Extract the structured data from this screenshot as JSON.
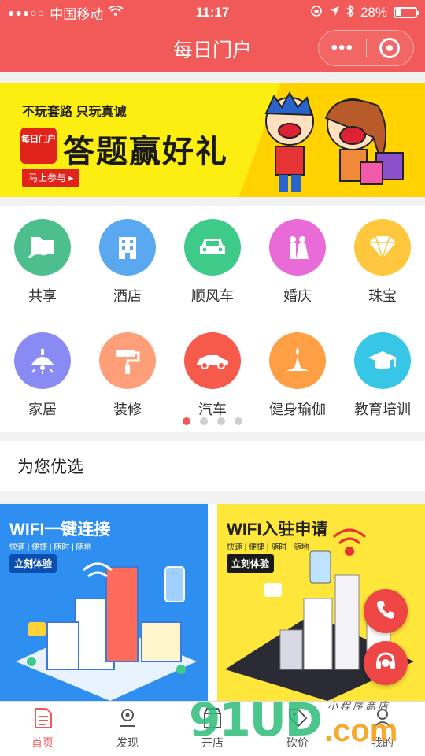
{
  "status": {
    "carrier": "中国移动",
    "time": "11:17",
    "battery": "28%",
    "battery_level": 0.28
  },
  "nav": {
    "title": "每日门户"
  },
  "banner": {
    "slogan": "不玩套路  只玩真诚",
    "logo": "每日门户",
    "headline": "答题赢好礼",
    "cta": "马上参与"
  },
  "categories": [
    {
      "label": "共享",
      "color": "#4cbf8c",
      "icon": "folder-hand-icon"
    },
    {
      "label": "酒店",
      "color": "#5aa8f0",
      "icon": "building-icon"
    },
    {
      "label": "顺风车",
      "color": "#3ecb8a",
      "icon": "car-front-icon"
    },
    {
      "label": "婚庆",
      "color": "#e86bd7",
      "icon": "couple-icon"
    },
    {
      "label": "珠宝",
      "color": "#ffc73d",
      "icon": "diamond-icon"
    },
    {
      "label": "家居",
      "color": "#8a8af5",
      "icon": "lamp-icon"
    },
    {
      "label": "装修",
      "color": "#ff9f7a",
      "icon": "paint-roller-icon"
    },
    {
      "label": "汽车",
      "color": "#f55a4a",
      "icon": "car-side-icon"
    },
    {
      "label": "健身瑜伽",
      "color": "#ff9f45",
      "icon": "yoga-icon"
    },
    {
      "label": "教育培训",
      "color": "#38c6e6",
      "icon": "graduation-cap-icon"
    }
  ],
  "pager": {
    "pages": 4,
    "active": 0
  },
  "section": {
    "title": "为您优选"
  },
  "cards": [
    {
      "title": "WIFI一键连接",
      "subtitle": "快速 | 便捷 | 随时 | 随地",
      "button": "立刻体验"
    },
    {
      "title": "WIFI入驻申请",
      "subtitle": "快速 | 便捷 | 随时 | 随地",
      "button": "立刻体验"
    }
  ],
  "tabs": [
    {
      "label": "首页",
      "icon": "document-icon",
      "active": true
    },
    {
      "label": "发现",
      "icon": "location-icon",
      "active": false
    },
    {
      "label": "开店",
      "icon": "store-icon",
      "active": false
    },
    {
      "label": "砍价",
      "icon": "tag-icon",
      "active": false
    },
    {
      "label": "我的",
      "icon": "user-icon",
      "active": false
    }
  ],
  "watermark": {
    "brand": "91UD",
    "domain": ".com",
    "tagline": "小程序商店"
  },
  "colors": {
    "primary": "#f25a5a",
    "banner_bg": "#fcee10"
  }
}
